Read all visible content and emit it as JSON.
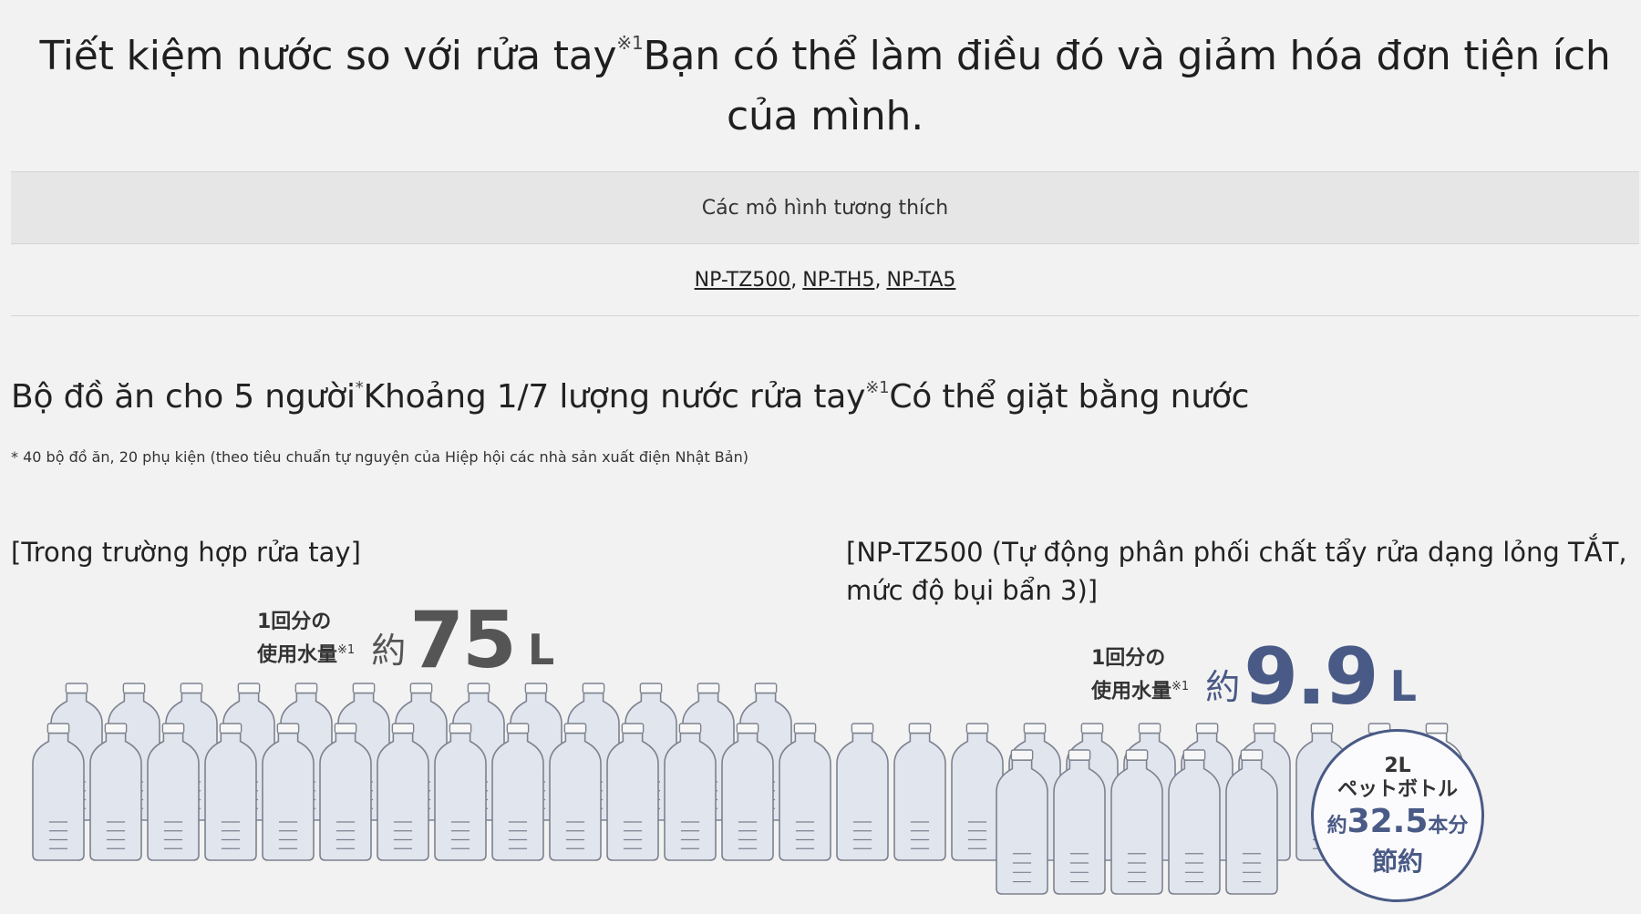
{
  "headline": {
    "text_before": "Tiết kiệm nước so với rửa tay",
    "note_mark": "※1",
    "text_after": "Bạn có thể làm điều đó và giảm hóa đơn tiện ích của mình."
  },
  "compat_table": {
    "header": "Các mô hình tương thích",
    "models": [
      "NP-TZ500",
      "NP-TH5",
      "NP-TA5"
    ],
    "separator": ","
  },
  "subhead": {
    "part1": "Bộ đồ ăn cho 5 người",
    "asterisk": "*",
    "part2": "Khoảng 1/7 lượng nước rửa tay",
    "note_mark": "※1",
    "part3": "Có thể giặt bằng nước"
  },
  "footnote": "* 40 bộ đồ ăn, 20 phụ kiện (theo tiêu chuẩn tự nguyện của Hiệp hội các nhà sản xuất điện Nhật Bản)",
  "left_case": {
    "title": "[Trong trường hợp rửa tay]",
    "label_line1": "1回分の",
    "label_line2": "使用水量",
    "note_mark": "※1",
    "approx": "約",
    "value": "75",
    "unit": "L",
    "bottles_full": 37.5,
    "bottles_rendered": 38
  },
  "right_case": {
    "title": "[NP-TZ500 (Tự động phân phối chất tẩy rửa dạng lỏng TẮT, mức độ bụi bẩn 3)]",
    "label_line1": "1回分の",
    "label_line2": "使用水量",
    "note_mark": "※1",
    "approx": "約",
    "value": "9.9",
    "unit": "L",
    "bottles_full": 4.95
  },
  "badge": {
    "line1": "2L",
    "line2": "ペットボトル",
    "approx": "約",
    "count": "32.5",
    "count_suffix": "本分",
    "line4": "節約"
  },
  "colors": {
    "background": "#f2f2f2",
    "accent": "#4a5a86",
    "bottle_fill": "#e1e5ed",
    "bottle_stroke": "#7d8290"
  }
}
